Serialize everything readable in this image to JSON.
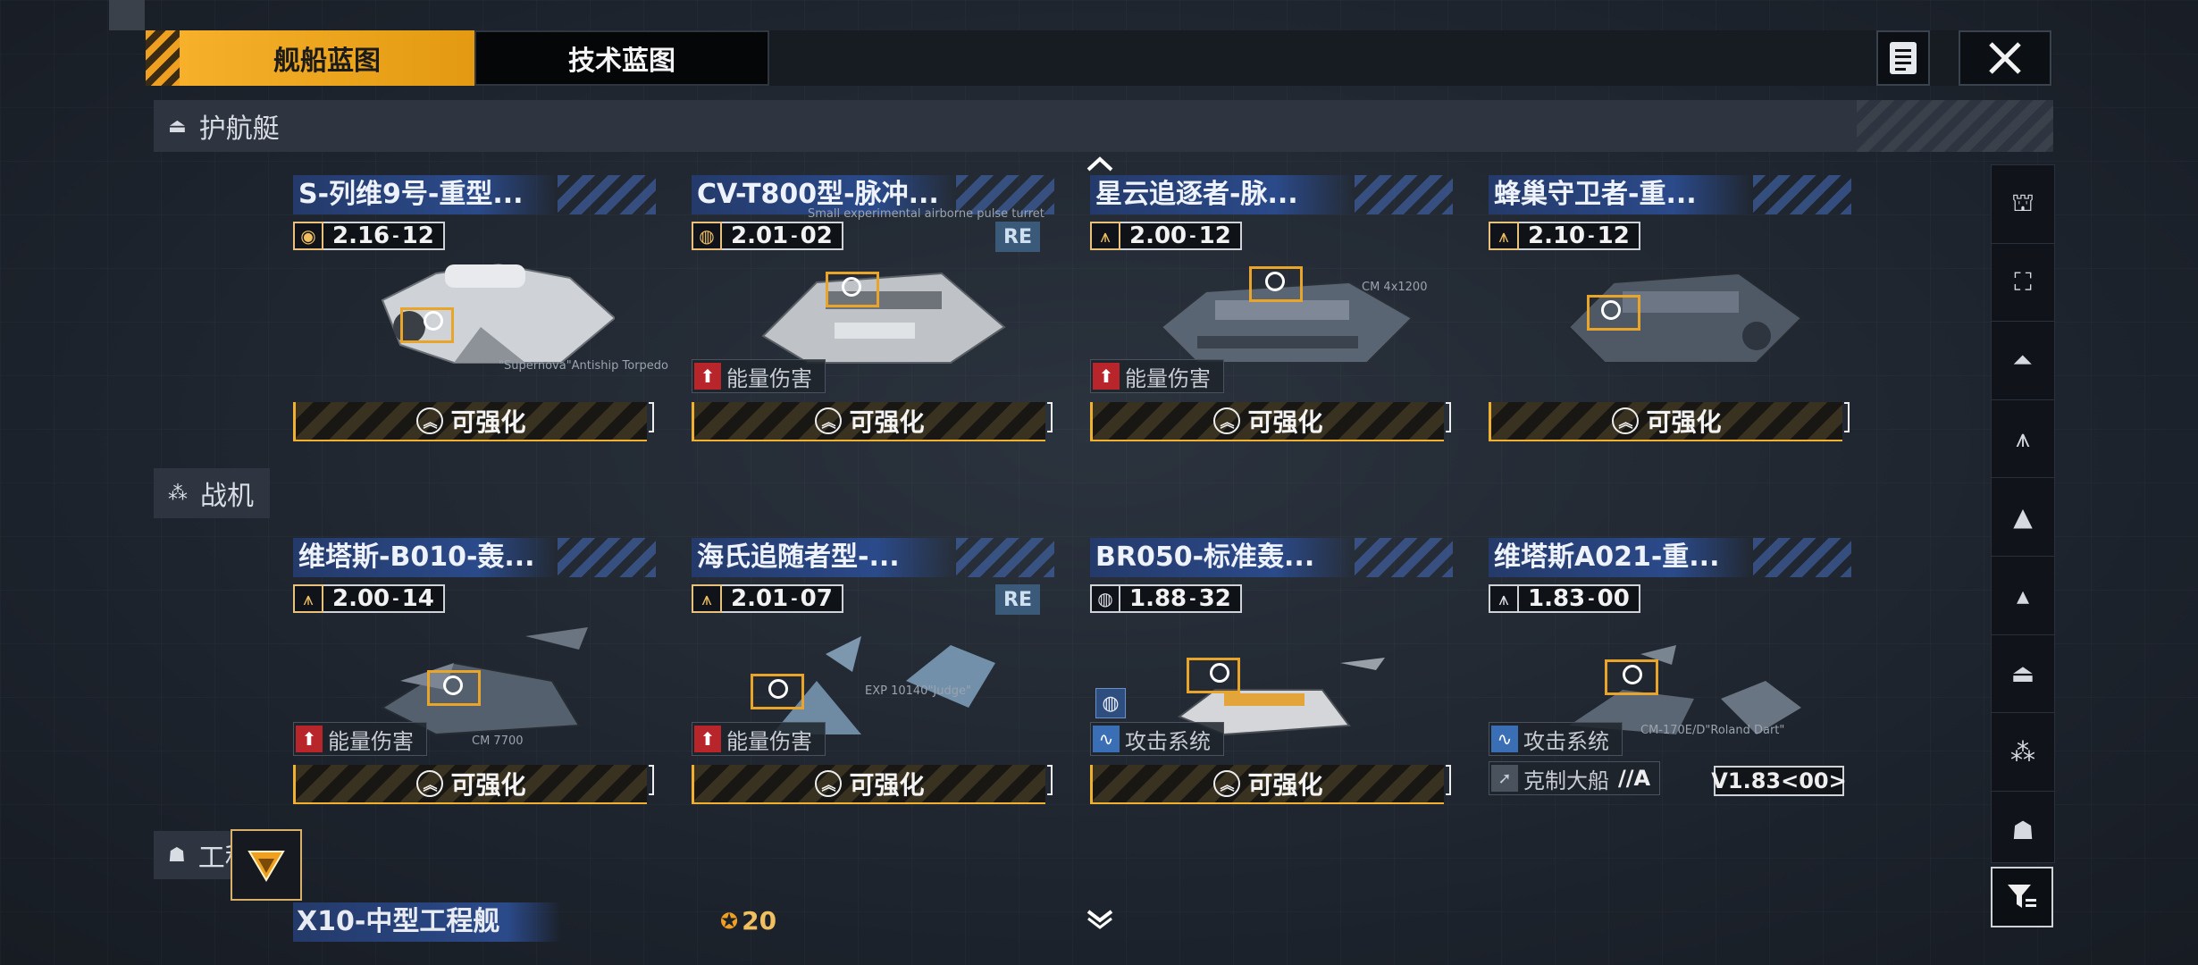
{
  "tabs": {
    "ship_blueprint": "舰船蓝图",
    "tech_blueprint": "技术蓝图"
  },
  "sections": {
    "escort": "护航艇",
    "fighter": "战机",
    "engineering": "工程"
  },
  "cards": [
    {
      "title": "S-列维9号-重型...",
      "level": "2.16",
      "sub": "12",
      "icon": "torpedo-icon",
      "tag": "",
      "re": "",
      "enhance": "可强化",
      "annotation": "\"Supernova\"Antiship Torpedo"
    },
    {
      "title": "CV-T800型-脉冲...",
      "level": "2.01",
      "sub": "02",
      "icon": "globe-icon",
      "tag": "能量伤害",
      "re": "RE",
      "enhance": "可强化",
      "annotation": "Small experimental airborne pulse turret"
    },
    {
      "title": "星云追逐者-脉...",
      "level": "2.00",
      "sub": "12",
      "icon": "fighter-icon",
      "tag": "能量伤害",
      "re": "",
      "enhance": "可强化",
      "annotation": "CM 4x1200"
    },
    {
      "title": "蜂巢守卫者-重...",
      "level": "2.10",
      "sub": "12",
      "icon": "fighter-icon",
      "tag": "",
      "re": "",
      "enhance": "可强化",
      "annotation": ""
    },
    {
      "title": "维塔斯-B010-轰...",
      "level": "2.00",
      "sub": "14",
      "icon": "fighter-icon",
      "tag": "能量伤害",
      "re": "",
      "enhance": "可强化",
      "annotation": "CM 7700"
    },
    {
      "title": "海氏追随者型-...",
      "level": "2.01",
      "sub": "07",
      "icon": "fighter-icon",
      "tag": "能量伤害",
      "re": "RE",
      "enhance": "可强化",
      "annotation": "EXP 10140\"Judge\""
    },
    {
      "title": "BR050-标准轰...",
      "level": "1.88",
      "sub": "32",
      "icon": "globe-icon",
      "tag": "攻击系统",
      "re": "",
      "enhance": "可强化",
      "annotation": ""
    },
    {
      "title": "维塔斯A021-重...",
      "level": "1.83",
      "sub": "00",
      "icon": "fighter-icon",
      "tag": "攻击系统",
      "re": "",
      "enhance": "",
      "annotation": "CM-170E/D\"Roland Dart\""
    }
  ],
  "counter_card": {
    "tag2": "克制大船",
    "tag2_rank": "//A",
    "version": "V1.83<00>"
  },
  "engineering_card": {
    "title": "X10-中型工程舰",
    "count": "20"
  },
  "colors": {
    "accent": "#f0a020",
    "title_blue": "#2b4a8a",
    "energy_red": "#b8262c",
    "attack_blue": "#3b6fb5"
  }
}
